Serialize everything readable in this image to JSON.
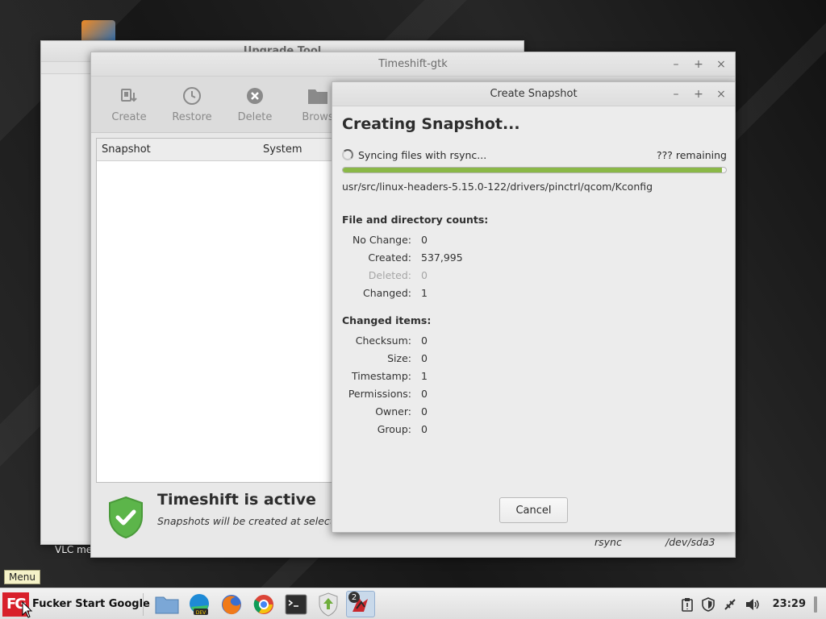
{
  "desktop": {
    "bottom_label": "VLC me"
  },
  "upgrade_window": {
    "title": "Upgrade Tool"
  },
  "timeshift": {
    "title": "Timeshift-gtk",
    "toolbar": [
      {
        "label": "Create",
        "icon": "create-snapshot-icon"
      },
      {
        "label": "Restore",
        "icon": "restore-clock-icon"
      },
      {
        "label": "Delete",
        "icon": "delete-icon"
      },
      {
        "label": "Brows",
        "icon": "folder-icon"
      }
    ],
    "columns": [
      "Snapshot",
      "System"
    ],
    "status_title": "Timeshift is active",
    "status_sub": "Snapshots will be created at selected i",
    "status_mode": "rsync",
    "status_device": "/dev/sda3"
  },
  "snapshot_dialog": {
    "title": "Create Snapshot",
    "heading": "Creating Snapshot...",
    "sync_text": "Syncing files with rsync...",
    "remaining": "??? remaining",
    "progress": 0.99,
    "current_path": "usr/src/linux-headers-5.15.0-122/drivers/pinctrl/qcom/Kconfig",
    "counts_title": "File and directory counts:",
    "counts": [
      {
        "label": "No Change:",
        "value": "0"
      },
      {
        "label": "Created:",
        "value": "537,995"
      },
      {
        "label": "Deleted:",
        "value": "0"
      },
      {
        "label": "Changed:",
        "value": "1"
      }
    ],
    "changed_title": "Changed items:",
    "changed": [
      {
        "label": "Checksum:",
        "value": "0"
      },
      {
        "label": "Size:",
        "value": "0"
      },
      {
        "label": "Timestamp:",
        "value": "1"
      },
      {
        "label": "Permissions:",
        "value": "0"
      },
      {
        "label": "Owner:",
        "value": "0"
      },
      {
        "label": "Group:",
        "value": "0"
      }
    ],
    "cancel_label": "Cancel"
  },
  "tooltip": "Menu",
  "taskbar": {
    "menu_logo": "FG",
    "menu_label": "Fucker Start Google",
    "group_count": "2",
    "clock": "23:29"
  },
  "colors": {
    "progress_fill": "#8ab847",
    "shield_green": "#5cb54a",
    "menu_red": "#d8202a"
  }
}
